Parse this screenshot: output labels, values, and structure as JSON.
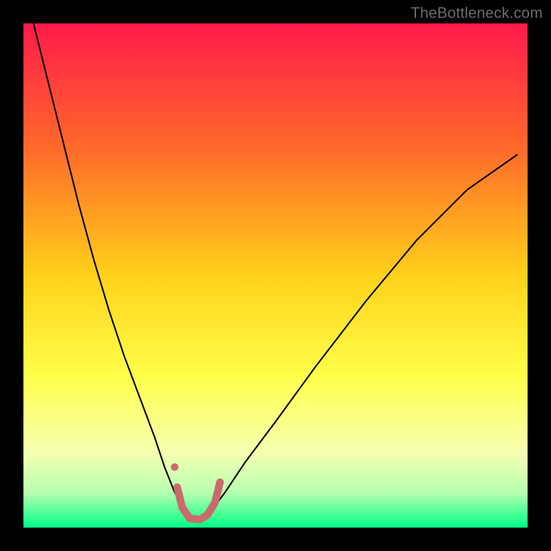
{
  "watermark": "TheBottleneck.com",
  "chart_data": {
    "type": "line",
    "title": "",
    "xlabel": "",
    "ylabel": "",
    "xlim": [
      0,
      100
    ],
    "ylim": [
      0,
      100
    ],
    "background_gradient": {
      "stops": [
        {
          "offset": 0,
          "color": "#ff1a4b"
        },
        {
          "offset": 25,
          "color": "#ff6a2a"
        },
        {
          "offset": 50,
          "color": "#ffd11a"
        },
        {
          "offset": 70,
          "color": "#ffff4a"
        },
        {
          "offset": 85,
          "color": "#f6ffb0"
        },
        {
          "offset": 93,
          "color": "#b8ffb0"
        },
        {
          "offset": 100,
          "color": "#00ff87"
        }
      ]
    },
    "series": [
      {
        "name": "curve",
        "color": "#000000",
        "width": 2.2,
        "x": [
          2,
          5,
          8,
          11,
          14,
          17,
          20,
          23,
          26,
          28,
          30,
          32,
          33.5,
          35,
          37,
          40,
          44,
          50,
          58,
          68,
          78,
          88,
          98
        ],
        "y": [
          100,
          88,
          76,
          64,
          53,
          43,
          34,
          26,
          18,
          12,
          7,
          3.5,
          1.5,
          1.5,
          3,
          7,
          13,
          21,
          32,
          45,
          57,
          67,
          74
        ]
      },
      {
        "name": "highlight",
        "color": "#c96b6b",
        "width": 11,
        "linecap": "round",
        "x": [
          30.5,
          31.5,
          33,
          35,
          36.5,
          38,
          39
        ],
        "y": [
          8,
          4,
          1.8,
          1.6,
          2.5,
          5,
          9
        ]
      }
    ],
    "markers": [
      {
        "x": 30,
        "y": 12,
        "r": 5.5,
        "color": "#c96b6b"
      }
    ]
  }
}
